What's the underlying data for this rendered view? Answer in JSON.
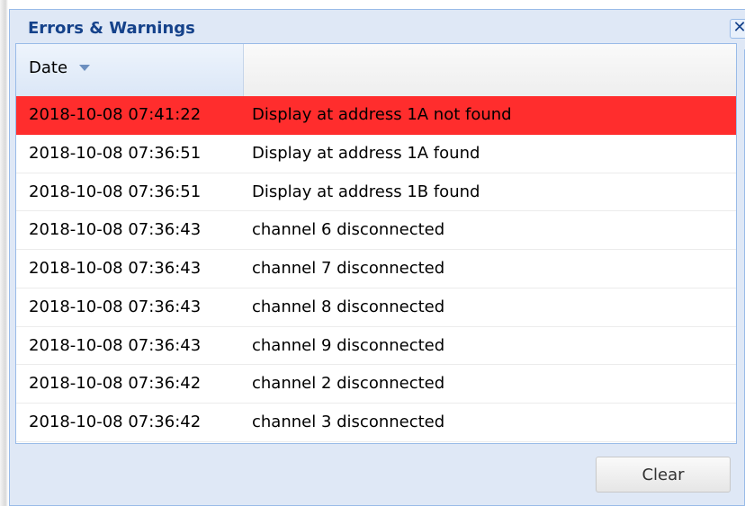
{
  "dialog": {
    "title": "Errors & Warnings",
    "close_label": "✕"
  },
  "grid": {
    "columns": [
      "Date",
      ""
    ],
    "sort_column": "Date",
    "sort_direction": "descending",
    "rows": [
      {
        "date": "2018-10-08 07:41:22",
        "message": "Display at address 1A not found",
        "severity": "error"
      },
      {
        "date": "2018-10-08 07:36:51",
        "message": "Display at address 1A found",
        "severity": "info"
      },
      {
        "date": "2018-10-08 07:36:51",
        "message": "Display at address 1B found",
        "severity": "info"
      },
      {
        "date": "2018-10-08 07:36:43",
        "message": "channel 6 disconnected",
        "severity": "info"
      },
      {
        "date": "2018-10-08 07:36:43",
        "message": "channel 7 disconnected",
        "severity": "info"
      },
      {
        "date": "2018-10-08 07:36:43",
        "message": "channel 8 disconnected",
        "severity": "info"
      },
      {
        "date": "2018-10-08 07:36:43",
        "message": "channel 9 disconnected",
        "severity": "info"
      },
      {
        "date": "2018-10-08 07:36:42",
        "message": "channel 2 disconnected",
        "severity": "info"
      },
      {
        "date": "2018-10-08 07:36:42",
        "message": "channel 3 disconnected",
        "severity": "info"
      }
    ]
  },
  "footer": {
    "clear_label": "Clear"
  },
  "colors": {
    "error_row": "#ff2d2d",
    "title_text": "#15428b",
    "window_background": "#dfe8f6",
    "border": "#99bbe8"
  },
  "icons": {
    "sort": "sort-desc-arrow-icon",
    "close": "close-icon"
  }
}
